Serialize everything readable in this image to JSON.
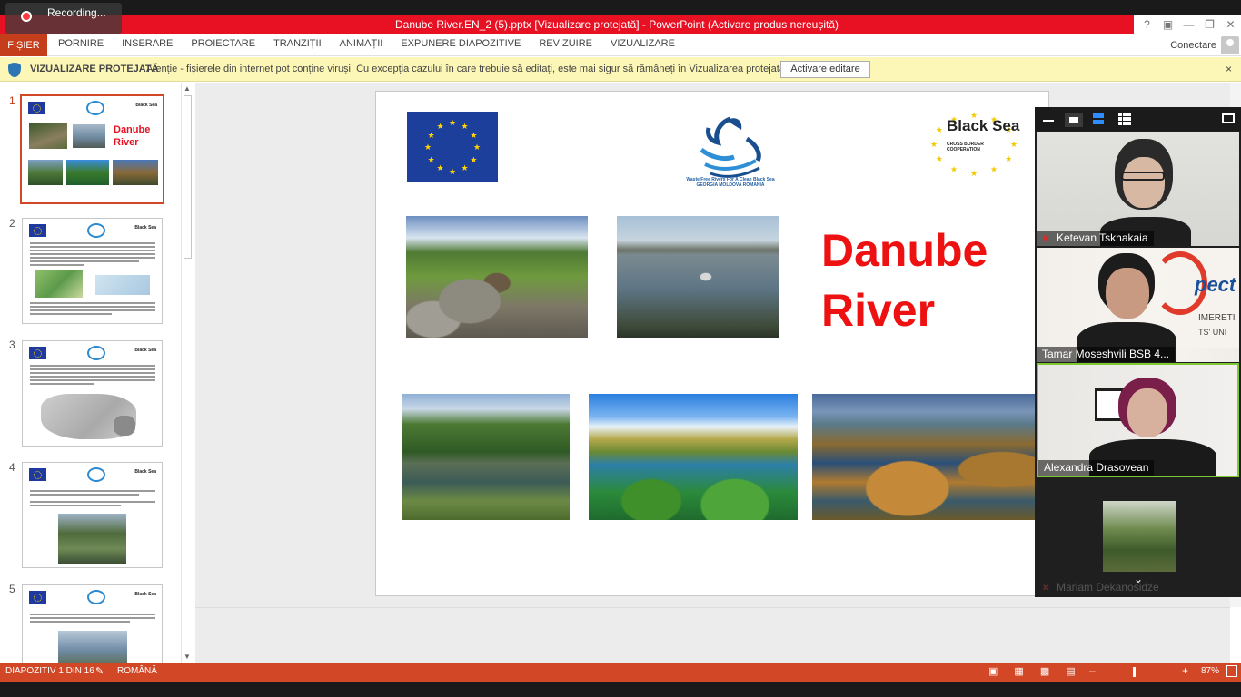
{
  "recording": {
    "label": "Recording..."
  },
  "window": {
    "title": "Danube River.EN_2 (5).pptx [Vizualizare protejată]  -  PowerPoint (Activare produs nereușită)"
  },
  "ribbon": {
    "file_tab": "FIȘIER",
    "tabs": [
      "PORNIRE",
      "INSERARE",
      "PROIECTARE",
      "TRANZIȚII",
      "ANIMAȚII",
      "EXPUNERE DIAPOZITIVE",
      "REVIZUIRE",
      "VIZUALIZARE"
    ],
    "sign_in": "Conectare"
  },
  "protected_view": {
    "title": "VIZUALIZARE PROTEJATĂ",
    "message": "Atenție - fișierele din internet pot conține viruși. Cu excepția cazului în care trebuie să editați, este mai sigur să rămâneți în Vizualizarea protejată.",
    "button": "Activare editare",
    "close": "×"
  },
  "thumbnails": {
    "numbers": [
      "1",
      "2",
      "3",
      "4",
      "5"
    ],
    "slide1_title_line1": "Danube",
    "slide1_title_line2": "River",
    "black_sea_label": "Black Sea"
  },
  "slide": {
    "title_line1": "Danube",
    "title_line2": "River",
    "center_logo_caption_line1": "Waste Free Rivers For A Clean Black Sea",
    "center_logo_caption_line2": "GEORGIA   MOLDOVA   ROMANIA",
    "partner_logo_word": "Black Sea",
    "partner_logo_sub": "CROSS BORDER COOPERATION"
  },
  "zoom": {
    "participants": [
      {
        "name": "Ketevan Tskhakaia",
        "muted": true
      },
      {
        "name": "Tamar Moseshvili BSB 4...",
        "muted": false
      },
      {
        "name": "Alexandra Drasovean",
        "muted": false,
        "speaking": true
      },
      {
        "name": "Mariam Dekanosidze",
        "muted": true
      }
    ]
  },
  "status": {
    "slide_counter": "DIAPOZITIV 1 DIN 16",
    "language": "ROMÂNĂ",
    "zoom_level": "87%",
    "zoom_fraction": 0.43
  },
  "colors": {
    "accent": "#d24726",
    "title_bar": "#e81123",
    "slide_title": "#ee1111",
    "protected_bar": "#fcf7b6",
    "speaking_border": "#7ec832"
  }
}
